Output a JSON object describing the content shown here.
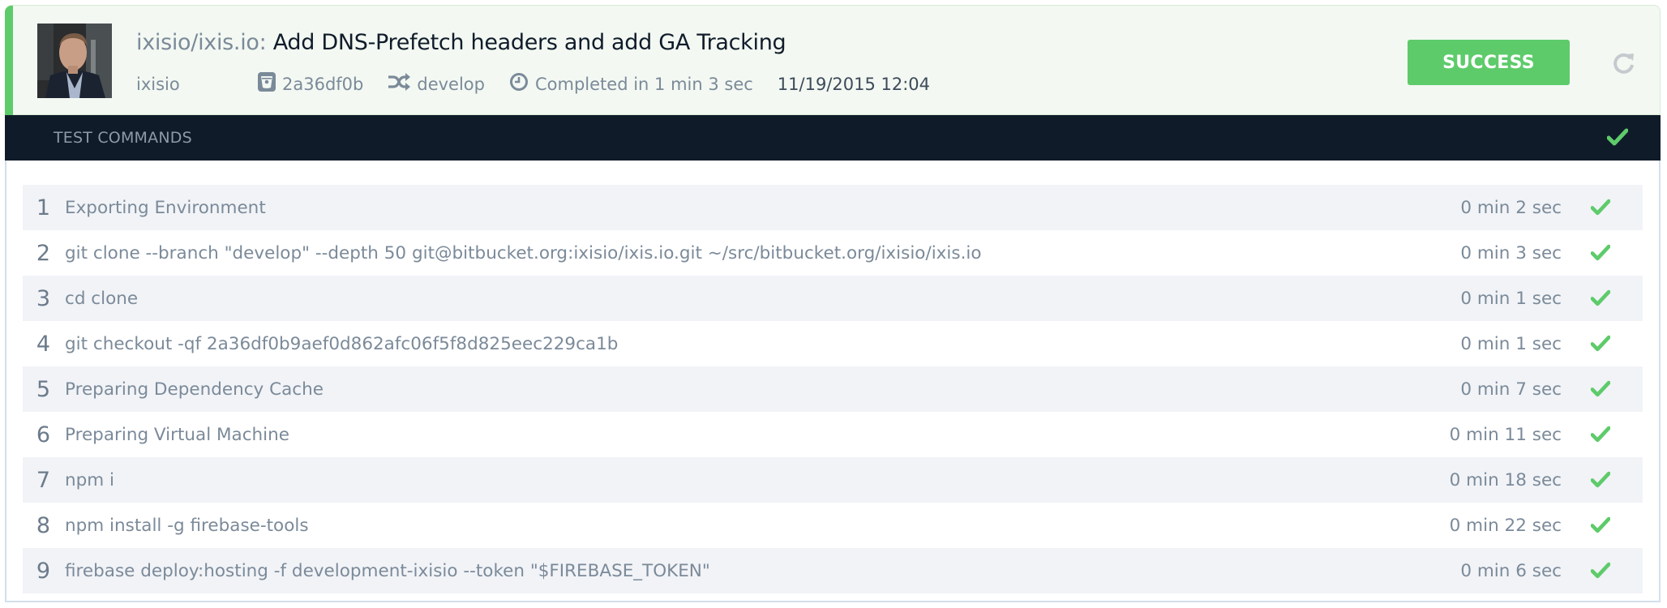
{
  "build": {
    "repo": "ixisio/ixis.io:",
    "commit_message": "Add DNS-Prefetch headers and add GA Tracking",
    "author": "ixisio",
    "commit_hash": "2a36df0b",
    "branch": "develop",
    "duration": "Completed in 1 min 3 sec",
    "timestamp": "11/19/2015 12:04",
    "status_label": "SUCCESS",
    "status_color": "#5ecb6b",
    "icons": {
      "commit": "bitbucket-icon",
      "branch": "shuffle-icon",
      "duration": "clock-icon",
      "rebuild": "refresh-icon"
    }
  },
  "section": {
    "title": "TEST COMMANDS",
    "status_icon": "check-icon"
  },
  "commands": [
    {
      "num": "1",
      "text": "Exporting Environment",
      "time": "0 min 2 sec",
      "status": "success"
    },
    {
      "num": "2",
      "text": "git clone --branch \"develop\" --depth 50 git@bitbucket.org:ixisio/ixis.io.git ~/src/bitbucket.org/ixisio/ixis.io",
      "time": "0 min 3 sec",
      "status": "success"
    },
    {
      "num": "3",
      "text": "cd clone",
      "time": "0 min 1 sec",
      "status": "success"
    },
    {
      "num": "4",
      "text": "git checkout -qf 2a36df0b9aef0d862afc06f5f8d825eec229ca1b",
      "time": "0 min 1 sec",
      "status": "success"
    },
    {
      "num": "5",
      "text": "Preparing Dependency Cache",
      "time": "0 min 7 sec",
      "status": "success"
    },
    {
      "num": "6",
      "text": "Preparing Virtual Machine",
      "time": "0 min 11 sec",
      "status": "success"
    },
    {
      "num": "7",
      "text": "npm i",
      "time": "0 min 18 sec",
      "status": "success"
    },
    {
      "num": "8",
      "text": "npm install -g firebase-tools",
      "time": "0 min 22 sec",
      "status": "success"
    },
    {
      "num": "9",
      "text": "firebase deploy:hosting -f development-ixisio --token \"$FIREBASE_TOKEN\"",
      "time": "0 min 6 sec",
      "status": "success"
    }
  ]
}
